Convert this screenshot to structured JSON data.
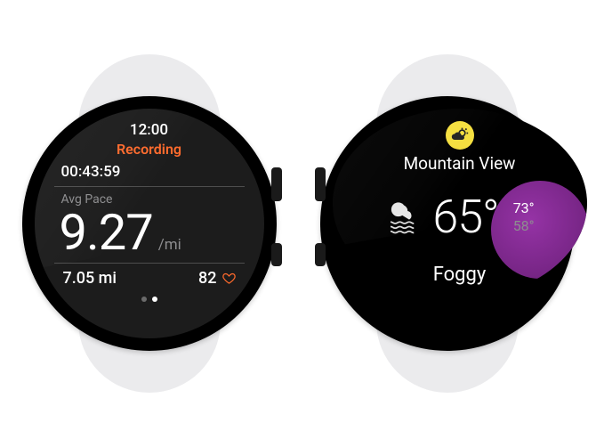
{
  "fitness": {
    "time": "12:00",
    "status": "Recording",
    "elapsed": "00:43:59",
    "pace_label": "Avg Pace",
    "pace_value": "9.27",
    "pace_unit": "/mi",
    "distance": "7.05 mi",
    "heart_rate": "82",
    "page_indicator": {
      "count": 2,
      "active": 1
    }
  },
  "weather": {
    "location": "Mountain View",
    "current_temp": "65°",
    "high": "73°",
    "low": "58°",
    "condition": "Foggy"
  },
  "colors": {
    "accent_orange": "#ff6a2c",
    "badge_yellow": "#f5df3e",
    "blob_purple": "#b03cc3",
    "muted": "#8d8d8f"
  }
}
